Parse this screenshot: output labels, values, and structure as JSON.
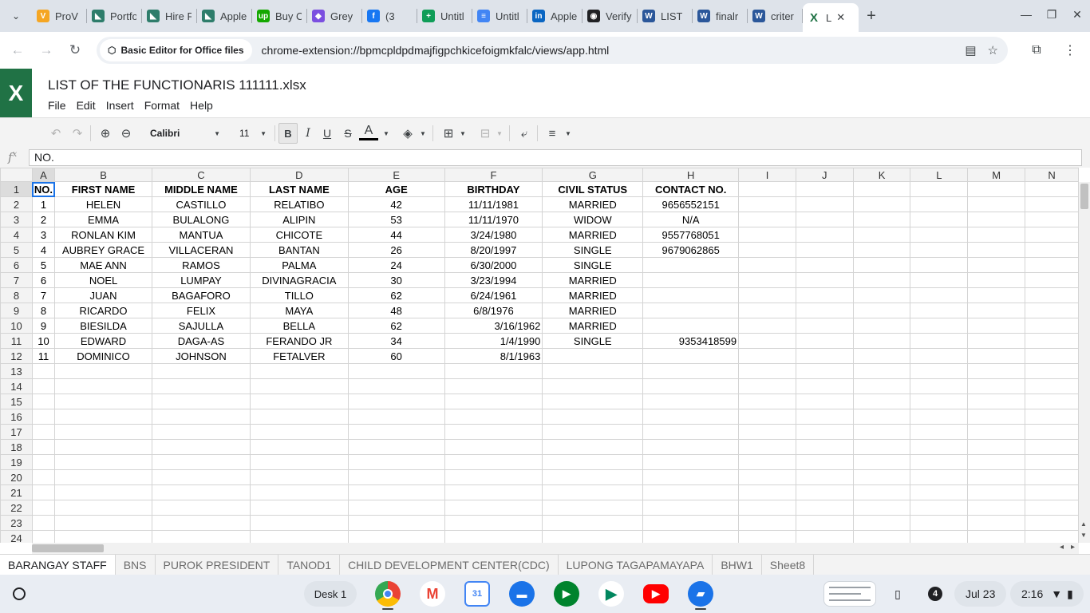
{
  "browser": {
    "tabs": [
      {
        "label": "ProV",
        "color": "#f5a623",
        "glyph": "V"
      },
      {
        "label": "Portfo",
        "color": "#2e7d6b",
        "glyph": "◣"
      },
      {
        "label": "Hire F",
        "color": "#2e7d6b",
        "glyph": "◣"
      },
      {
        "label": "Apple",
        "color": "#2e7d6b",
        "glyph": "◣"
      },
      {
        "label": "Buy C",
        "color": "#14a800",
        "glyph": "up"
      },
      {
        "label": "Grey",
        "color": "#7b4fe0",
        "glyph": "◆"
      },
      {
        "label": "(3",
        "color": "#1877f2",
        "glyph": "f"
      },
      {
        "label": "Untitl",
        "color": "#0f9d58",
        "glyph": "+"
      },
      {
        "label": "Untitl",
        "color": "#4285f4",
        "glyph": "≡"
      },
      {
        "label": "Apple",
        "color": "#0a66c2",
        "glyph": "in"
      },
      {
        "label": "Verify",
        "color": "#202124",
        "glyph": "◉"
      },
      {
        "label": "LIST",
        "color": "#2b579a",
        "glyph": "W"
      },
      {
        "label": "finalr",
        "color": "#2b579a",
        "glyph": "W"
      },
      {
        "label": "criter",
        "color": "#2b579a",
        "glyph": "W"
      }
    ],
    "active_tab": {
      "label": "L",
      "color": "#207245",
      "glyph": "X"
    },
    "site_chip": "Basic Editor for Office files",
    "url": "chrome-extension://bpmcpldpdmajfigpchkicefoigmkfalc/views/app.html"
  },
  "app": {
    "logo_letter": "X",
    "title": "LIST OF THE FUNCTIONARIS 111111.xlsx",
    "menu": [
      "File",
      "Edit",
      "Insert",
      "Format",
      "Help"
    ],
    "toolbar": {
      "font": "Calibri",
      "size": "11"
    },
    "formula": {
      "fx_label": "f",
      "fx_sup": "x",
      "value": "NO."
    }
  },
  "sheet": {
    "columns": [
      "A",
      "B",
      "C",
      "D",
      "E",
      "F",
      "G",
      "H",
      "I",
      "J",
      "K",
      "L",
      "M",
      "N"
    ],
    "header_row": [
      "NO.",
      "FIRST NAME",
      "MIDDLE NAME",
      "LAST NAME",
      "AGE",
      "BIRTHDAY",
      "CIVIL STATUS",
      "CONTACT NO."
    ],
    "rows": [
      [
        "1",
        "HELEN",
        "CASTILLO",
        "RELATIBO",
        "42",
        "11/11/1981",
        "MARRIED",
        "9656552151"
      ],
      [
        "2",
        "EMMA",
        "BULALONG",
        "ALIPIN",
        "53",
        "11/11/1970",
        "WIDOW",
        "N/A"
      ],
      [
        "3",
        "RONLAN KIM",
        "MANTUA",
        "CHICOTE",
        "44",
        "3/24/1980",
        "MARRIED",
        "9557768051"
      ],
      [
        "4",
        "AUBREY GRACE",
        "VILLACERAN",
        "BANTAN",
        "26",
        "8/20/1997",
        "SINGLE",
        "9679062865"
      ],
      [
        "5",
        "MAE ANN",
        "RAMOS",
        "PALMA",
        "24",
        "6/30/2000",
        "SINGLE",
        ""
      ],
      [
        "6",
        "NOEL",
        "LUMPAY",
        "DIVINAGRACIA",
        "30",
        "3/23/1994",
        "MARRIED",
        ""
      ],
      [
        "7",
        "JUAN",
        "BAGAFORO",
        "TILLO",
        "62",
        "6/24/1961",
        "MARRIED",
        ""
      ],
      [
        "8",
        "RICARDO",
        "FELIX",
        "MAYA",
        "48",
        "6/8/1976",
        "MARRIED",
        ""
      ],
      [
        "9",
        "BIESILDA",
        "SAJULLA",
        "BELLA",
        "62",
        "3/16/1962",
        "MARRIED",
        ""
      ],
      [
        "10",
        "EDWARD",
        "DAGA-AS",
        "FERANDO JR",
        "34",
        "1/4/1990",
        "SINGLE",
        "9353418599"
      ],
      [
        "11",
        "DOMINICO",
        "JOHNSON",
        "FETALVER",
        "60",
        "8/1/1963",
        "",
        ""
      ]
    ],
    "row_numbers": [
      "1",
      "2",
      "3",
      "4",
      "5",
      "6",
      "7",
      "8",
      "9",
      "10",
      "11",
      "12",
      "13",
      "14",
      "15",
      "16",
      "17",
      "18",
      "19",
      "20",
      "21",
      "22",
      "23",
      "24"
    ],
    "tabs": [
      "BARANGAY STAFF",
      "BNS",
      "PUROK PRESIDENT",
      "TANOD1",
      "CHILD DEVELOPMENT CENTER(CDC)",
      "LUPONG TAGAPAMAYAPA",
      "BHW1",
      "Sheet8"
    ]
  },
  "shelf": {
    "desk_label": "Desk 1",
    "notification_count": "4",
    "date": "Jul 23",
    "time": "2:16"
  }
}
